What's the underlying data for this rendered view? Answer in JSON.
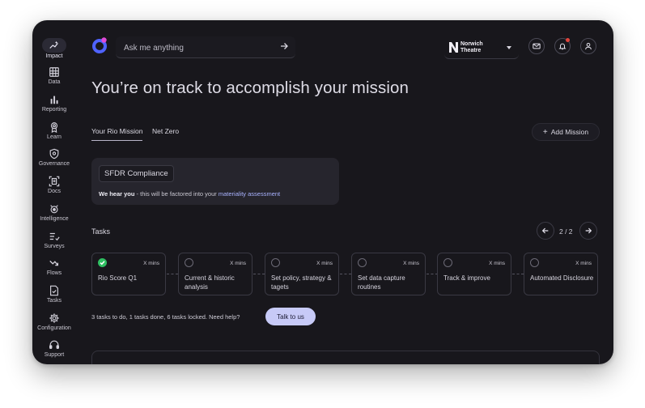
{
  "sidebar": {
    "items": [
      {
        "label": "Impact",
        "icon": "sparkle-chart-icon"
      },
      {
        "label": "Data",
        "icon": "grid-icon"
      },
      {
        "label": "Reporting",
        "icon": "bar-chart-icon"
      },
      {
        "label": "Learn",
        "icon": "award-icon"
      },
      {
        "label": "Governance",
        "icon": "shield-icon"
      },
      {
        "label": "Docs",
        "icon": "document-scan-icon"
      },
      {
        "label": "Intelligence",
        "icon": "brain-icon"
      },
      {
        "label": "Surveys",
        "icon": "checklist-icon"
      },
      {
        "label": "Flows",
        "icon": "flow-arrow-icon"
      },
      {
        "label": "Tasks",
        "icon": "task-file-icon"
      },
      {
        "label": "Configuration",
        "icon": "gear-icon"
      },
      {
        "label": "Support",
        "icon": "headset-icon"
      }
    ]
  },
  "header": {
    "search_placeholder": "Ask me anything",
    "org_name": "Norwich Theatre"
  },
  "main": {
    "title": "You’re on track to accomplish your mission",
    "tabs": [
      {
        "label": "Your Rio Mission",
        "active": true
      },
      {
        "label": "Net Zero",
        "active": false
      }
    ],
    "add_mission_label": "Add Mission",
    "feedback_card": {
      "chip": "SFDR Compliance",
      "bold": "We hear you",
      "text": " - this will be factored into your ",
      "link": "materiality assessment"
    },
    "tasks_heading": "Tasks",
    "pager": "2 / 2",
    "tasks": [
      {
        "name": "Rio Score Q1",
        "mins": "X mins",
        "done": true
      },
      {
        "name": "Current & historic analysis",
        "mins": "X mins",
        "done": false
      },
      {
        "name": "Set policy, strategy & tagets",
        "mins": "X mins",
        "done": false
      },
      {
        "name": "Set data capture routines",
        "mins": "X mins",
        "done": false
      },
      {
        "name": "Track & improve",
        "mins": "X mins",
        "done": false
      },
      {
        "name": "Automated Disclosure",
        "mins": "X mins",
        "done": false
      }
    ],
    "status_text": "3 tasks to do, 1 tasks done, 6 tasks locked. Need help?",
    "talk_button": "Talk to us"
  },
  "colors": {
    "background": "#18171c",
    "accent": "#c7caf7",
    "done_green": "#2fbf62",
    "link": "#a9b3ff",
    "notification": "#e0443c"
  }
}
